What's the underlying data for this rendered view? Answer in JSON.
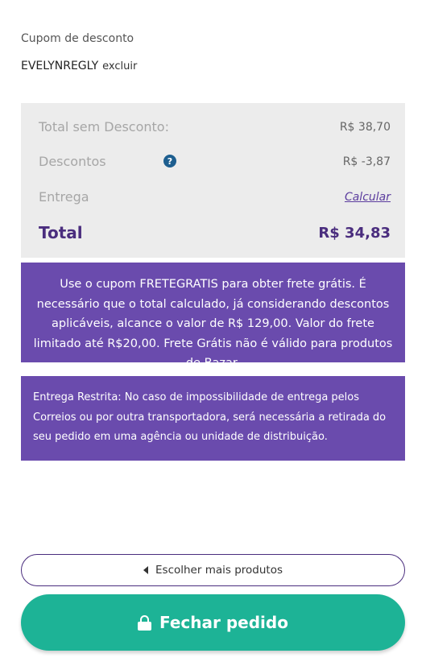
{
  "coupon": {
    "label": "Cupom de desconto",
    "code": "EVELYNREGLY",
    "remove_label": "excluir"
  },
  "summary": {
    "subtotal_label": "Total sem Desconto:",
    "subtotal_value": "R$ 38,70",
    "discount_label": "Descontos",
    "discount_value": "R$ -3,87",
    "help_icon_glyph": "?",
    "shipping_label": "Entrega",
    "shipping_action": "Calcular",
    "total_label": "Total",
    "total_value": "R$ 34,83"
  },
  "promo_text": "Use o cupom FRETEGRATIS para obter frete grátis. É necessário que o total calculado, já considerando descontos aplicáveis, alcance o valor de R$ 129,00. Valor do frete limitado até R$20,00. Frete Grátis não é válido para produtos de Bazar.",
  "restriction_text": "Entrega Restrita: No caso de impossibilidade de entrega pelos Correios ou por outra transportadora, será necessária a retirada do seu pedido em uma agência ou unidade de distribuição.",
  "buttons": {
    "more_products": "Escolher mais produtos",
    "checkout": "Fechar pedido"
  },
  "colors": {
    "brand_purple": "#6a4bad",
    "total_purple": "#4a2d7e",
    "checkout_green": "#1db396",
    "help_blue": "#1d5e8f"
  },
  "icons": {
    "help": "question-circle-icon",
    "back": "caret-left-icon",
    "checkout": "lock-icon"
  }
}
